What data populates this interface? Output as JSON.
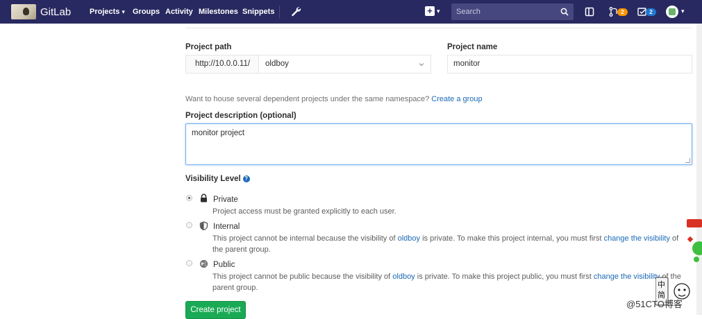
{
  "nav": {
    "brand": "GitLab",
    "items": [
      {
        "label": "Projects",
        "has_caret": true
      },
      {
        "label": "Groups"
      },
      {
        "label": "Activity"
      },
      {
        "label": "Milestones"
      },
      {
        "label": "Snippets"
      }
    ],
    "search_placeholder": "Search",
    "merge_requests_count": "2",
    "todos_count": "2",
    "colors": {
      "bar": "#292961",
      "mr_badge": "#fc9403",
      "todo_badge": "#1f78d1"
    }
  },
  "form": {
    "project_path_label": "Project path",
    "path_prefix": "http://10.0.0.11/",
    "namespace": "oldboy",
    "project_name_label": "Project name",
    "project_name": "monitor",
    "namespace_hint": "Want to house several dependent projects under the same namespace?",
    "create_group_link": "Create a group",
    "description_label": "Project description (optional)",
    "description": "monitor project",
    "visibility_label": "Visibility Level",
    "visibility": [
      {
        "title": "Private",
        "icon": "lock-icon",
        "selected": true,
        "desc_before": "Project access must be granted explicitly to each user."
      },
      {
        "title": "Internal",
        "icon": "shield-icon",
        "selected": false,
        "desc_before": "This project cannot be internal because the visibility of",
        "desc_link": "oldboy",
        "desc_mid": "is private. To make this project internal, you must first",
        "desc_link2": "change the visibility",
        "desc_after": "of",
        "desc_line2": "the parent group."
      },
      {
        "title": "Public",
        "icon": "globe-icon",
        "selected": false,
        "desc_before": "This project cannot be public because the visibility of",
        "desc_link": "oldboy",
        "desc_mid": "is private. To make this project public, you must first",
        "desc_link2": "change the visibility",
        "desc_after": "of the",
        "desc_line2": "parent group."
      }
    ],
    "create_button": "Create project",
    "primary_color": "#1aaa55"
  },
  "watermark": {
    "text": "@51CTO博客"
  }
}
